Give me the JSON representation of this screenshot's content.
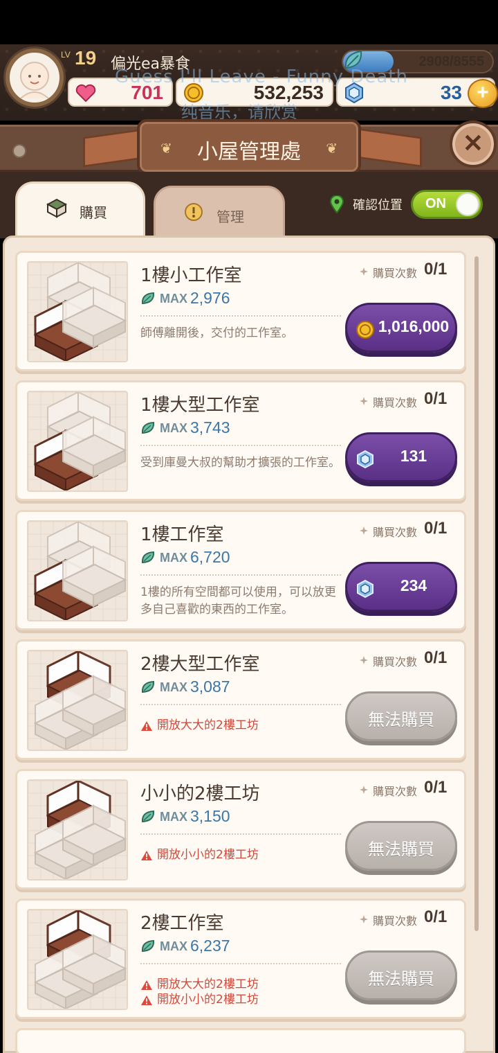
{
  "player": {
    "lv_label": "LV",
    "level": "19",
    "name": "偏光ea暴食",
    "energy": "2908/8555",
    "energy_fraction": 0.34,
    "hearts": "701",
    "coins": "532,253",
    "gems": "33"
  },
  "overlay": {
    "line1": "Guess I'll Leave - Funny Death",
    "line2": "纯音乐，请欣赏"
  },
  "header": {
    "title": "小屋管理處",
    "close": "✕"
  },
  "tabs": {
    "buy": "購買",
    "manage": "管理"
  },
  "confirm_position": {
    "label": "確認位置",
    "toggle": "ON"
  },
  "common": {
    "max_label": "MAX",
    "count_label": "購買次數",
    "unavailable": "無法購買"
  },
  "items": [
    {
      "name": "1樓小工作室",
      "max": "2,976",
      "count": "0/1",
      "description": "師傅離開後，交付的工作室。",
      "price_type": "coin",
      "price": "1,016,000"
    },
    {
      "name": "1樓大型工作室",
      "max": "3,743",
      "count": "0/1",
      "description": "受到庫曼大叔的幫助才擴張的工作室。",
      "price_type": "gem",
      "price": "131"
    },
    {
      "name": "1樓工作室",
      "max": "6,720",
      "count": "0/1",
      "description": "1樓的所有空間都可以使用，可以放更多自己喜歡的東西的工作室。",
      "price_type": "gem",
      "price": "234"
    },
    {
      "name": "2樓大型工作室",
      "max": "3,087",
      "count": "0/1",
      "requirements": [
        "開放大大的2樓工坊"
      ]
    },
    {
      "name": "小小的2樓工坊",
      "max": "3,150",
      "count": "0/1",
      "requirements": [
        "開放小小的2樓工坊"
      ]
    },
    {
      "name": "2樓工作室",
      "max": "6,237",
      "count": "0/1",
      "requirements": [
        "開放大大的2樓工坊",
        "開放小小的2樓工坊"
      ]
    }
  ],
  "colors": {
    "purple_button": "#5a2f86",
    "disabled_button": "#b7b0ab",
    "warning": "#d04a3c",
    "toggle_on": "#7fb51c"
  }
}
